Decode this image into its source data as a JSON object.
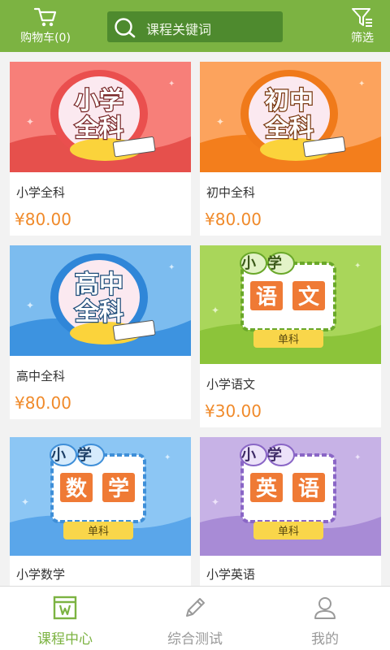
{
  "header": {
    "cart_label": "购物车(0)",
    "search_placeholder": "课程关键词",
    "filter_label": "筛选"
  },
  "colors": {
    "header_bg": "#7cb342",
    "accent_green": "#7cb342",
    "price_orange": "#f08a2a",
    "tab_inactive": "#999999"
  },
  "courses": [
    {
      "name": "小学全科",
      "price": "¥80.00",
      "banner_line1": "小学",
      "banner_line2": "全科",
      "theme": "red"
    },
    {
      "name": "初中全科",
      "price": "¥80.00",
      "banner_line1": "初中",
      "banner_line2": "全科",
      "theme": "orange"
    },
    {
      "name": "高中全科",
      "price": "¥80.00",
      "banner_line1": "高中",
      "banner_line2": "全科",
      "theme": "blue"
    },
    {
      "name": "小学语文",
      "price": "¥30.00",
      "banner_top": "小学",
      "banner_subject": [
        "语",
        "文"
      ],
      "banner_tag": "单科",
      "theme": "green"
    },
    {
      "name": "小学数学",
      "price": "",
      "banner_top": "小学",
      "banner_subject": [
        "数",
        "学"
      ],
      "banner_tag": "单科",
      "theme": "lightblue"
    },
    {
      "name": "小学英语",
      "price": "",
      "banner_top": "小学",
      "banner_subject": [
        "英",
        "语"
      ],
      "banner_tag": "单科",
      "theme": "purple"
    }
  ],
  "tabs": [
    {
      "label": "课程中心",
      "icon": "course-center-icon",
      "active": true
    },
    {
      "label": "综合测试",
      "icon": "pencil-icon",
      "active": false
    },
    {
      "label": "我的",
      "icon": "user-icon",
      "active": false
    }
  ]
}
